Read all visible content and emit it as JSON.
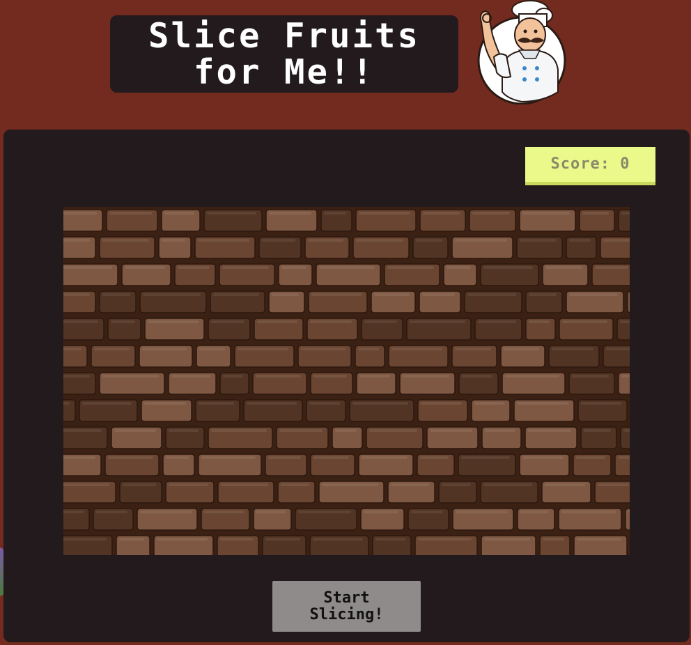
{
  "title": {
    "line1": "Slice Fruits",
    "line2": "for Me!!"
  },
  "mascot": {
    "icon": "chef-mascot-icon"
  },
  "score": {
    "label": "Score:",
    "value": "0"
  },
  "game": {
    "background": "brick-wall",
    "colors": {
      "mortar": "#3b2114",
      "brick": "#6a4632",
      "brick_light": "#7e5843",
      "brick_dark": "#513423"
    }
  },
  "start_button": {
    "line1": "Start",
    "line2": "Slicing!"
  },
  "colors": {
    "page_background": "#722b1e",
    "panel": "#231a1d",
    "score_background": "#eaf98a",
    "button_background": "#8f8b8b"
  }
}
